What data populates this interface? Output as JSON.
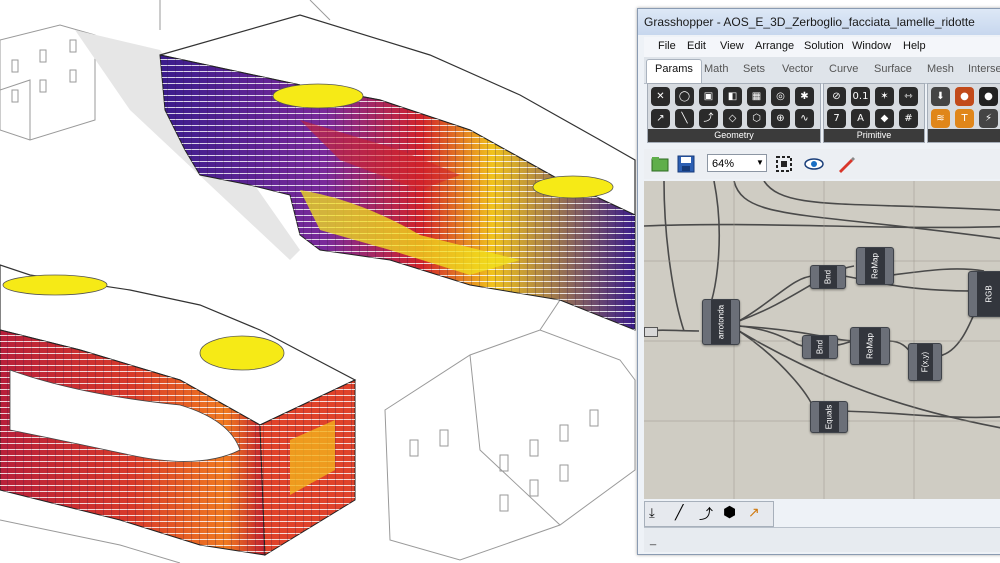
{
  "grasshopper": {
    "title": "Grasshopper - AOS_E_3D_Zerboglio_facciata_lamelle_ridotte",
    "menu": [
      "File",
      "Edit",
      "View",
      "Arrange",
      "Solution",
      "Window",
      "Help"
    ],
    "tabs": [
      "Params",
      "Math",
      "Sets",
      "Vector",
      "Curve",
      "Surface",
      "Mesh",
      "Intersect"
    ],
    "active_tab": "Params",
    "panels": {
      "geometry": "Geometry",
      "primitive": "Primitive"
    },
    "zoom": "64%",
    "components": {
      "arrotonda": "arrotonda",
      "bnd1": "Bnd",
      "bnd2": "Bnd",
      "remap1": "ReMap",
      "remap2": "ReMap",
      "fxy": "F(x,y)",
      "equals": "Equals",
      "rgb": "RGB"
    },
    "status": "_"
  },
  "colors": {
    "facade_low": "#3a1c8c",
    "facade_mid": "#d2232a",
    "facade_high": "#f2e21c",
    "solar_ellipse": "#f6ea16",
    "canvas_bg": "#cfccc3"
  }
}
